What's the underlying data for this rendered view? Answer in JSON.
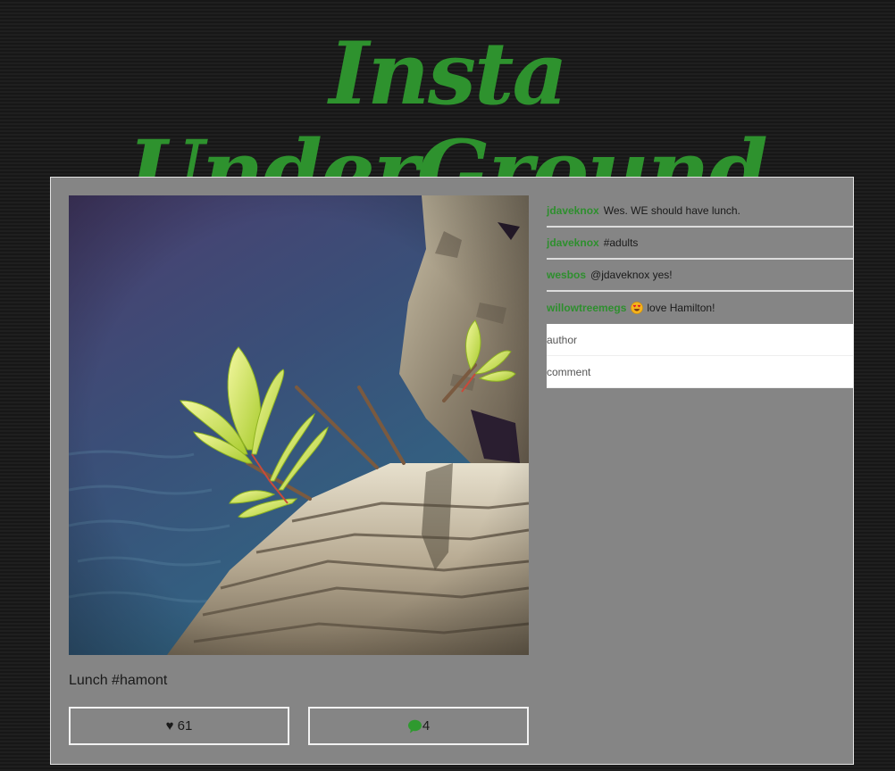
{
  "site": {
    "title": "Insta UnderGround",
    "brand_color": "#2e922e"
  },
  "post": {
    "image_alt": "Small green leafy plant growing out of a weathered tree stump beside blue water",
    "caption": "Lunch #hamont",
    "likes": "♥ 61",
    "comment_count": "4"
  },
  "comments": [
    {
      "user": "jdaveknox",
      "text": "Wes. WE should have lunch."
    },
    {
      "user": "jdaveknox",
      "text": "#adults"
    },
    {
      "user": "wesbos",
      "text": "@jdaveknox yes!"
    },
    {
      "user": "willowtreemegs",
      "emoji": "heart-eyes-emoji-icon",
      "text": "love Hamilton!"
    }
  ],
  "comment_form": {
    "author_placeholder": "author",
    "comment_placeholder": "comment"
  },
  "icons": {
    "like": "heart-icon",
    "comments": "speech-bubble-icon"
  }
}
